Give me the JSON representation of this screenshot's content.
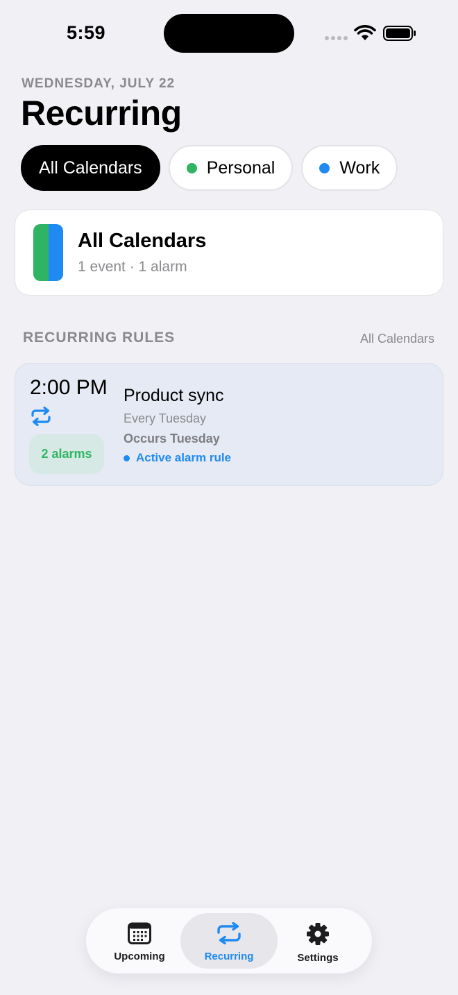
{
  "status_bar": {
    "time": "5:59"
  },
  "header": {
    "date": "WEDNESDAY, JULY 22",
    "title": "Recurring"
  },
  "filters": [
    {
      "label": "All Calendars",
      "active": true,
      "dot_color": null
    },
    {
      "label": "Personal",
      "active": false,
      "dot_color": "#2fb463"
    },
    {
      "label": "Work",
      "active": false,
      "dot_color": "#1f8af2"
    }
  ],
  "summary": {
    "title": "All Calendars",
    "subtitle": "1 event · 1 alarm",
    "colors": [
      "#2fb463",
      "#1f8af2"
    ]
  },
  "section": {
    "label": "RECURRING RULES",
    "scope": "All Calendars"
  },
  "rules": [
    {
      "time": "2:00 PM",
      "alarm_count_label": "2 alarms",
      "title": "Product sync",
      "repeat_text": "Every Tuesday",
      "occurs_text": "Occurs Tuesday",
      "status_text": "Active alarm rule"
    }
  ],
  "tabbar": {
    "tabs": [
      {
        "label": "Upcoming",
        "icon": "calendar-icon",
        "selected": false
      },
      {
        "label": "Recurring",
        "icon": "repeat-icon",
        "selected": true
      },
      {
        "label": "Settings",
        "icon": "gear-icon",
        "selected": false
      }
    ]
  },
  "colors": {
    "background": "#f0f0f5",
    "accent_blue": "#1f8af2",
    "accent_green": "#2fb463",
    "muted_text": "#8a8a8e"
  }
}
